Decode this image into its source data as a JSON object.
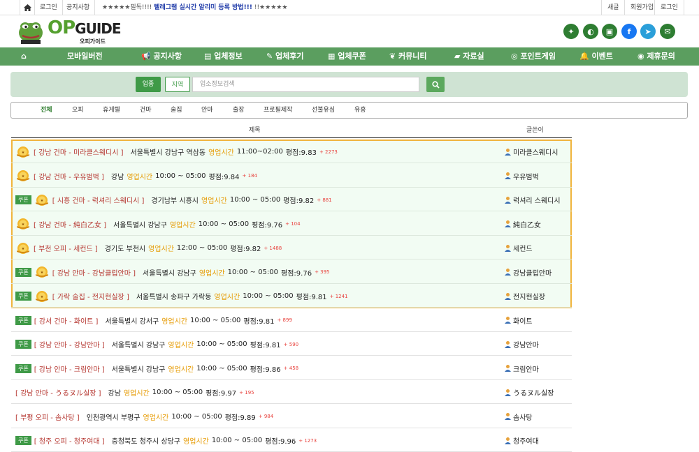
{
  "topbar": {
    "login": "로그인",
    "notice_link": "공지사항",
    "notice_prefix": "★★★★★필독!!!! ",
    "notice_bold": "텔레그램 실시간 알리미 등록 방법!!!",
    "notice_suffix": " !!★★★★★",
    "right": [
      "새글",
      "회원가입",
      "로그인"
    ]
  },
  "logo": {
    "main_op": "OP",
    "main_guide": "GUIDE",
    "sub": "오피가이드"
  },
  "social_icons": [
    {
      "name": "party-icon",
      "color": "#2e7d32",
      "glyph": "🎉"
    },
    {
      "name": "profile-icon",
      "color": "#2e7d32",
      "glyph": "◐"
    },
    {
      "name": "sim-card-icon",
      "color": "#2e7d32",
      "glyph": "▣"
    },
    {
      "name": "facebook-icon",
      "color": "#1877f2",
      "glyph": "f"
    },
    {
      "name": "telegram-icon",
      "color": "#2b9fd9",
      "glyph": "➤"
    },
    {
      "name": "mail-icon",
      "color": "#2e7d32",
      "glyph": "✉"
    }
  ],
  "nav": [
    "모바일버전",
    "공지사항",
    "업체정보",
    "업체후기",
    "업체쿠폰",
    "커뮤니티",
    "자료실",
    "포인트게임",
    "이벤트",
    "제휴문의"
  ],
  "search": {
    "btn_type": "업종",
    "btn_region": "지역",
    "placeholder": "업소정보검색"
  },
  "categories": [
    "전체",
    "오피",
    "휴게텔",
    "건마",
    "술집",
    "안마",
    "출장",
    "프로필제작",
    "선불유심",
    "유흥"
  ],
  "table": {
    "col_title": "제목",
    "col_author": "글쓴이"
  },
  "rows": [
    {
      "coupon": false,
      "medal": true,
      "bracket": "[ 강남 건마 - 미라클스웨디시 ]",
      "addr": "서울특별시 강남구 역삼동",
      "hours_label": "영업시간",
      "hours": "11:00~02:00",
      "score": "평점:9.83",
      "plus": "+ 2273",
      "author": "미라클스웨디시",
      "premium": true
    },
    {
      "coupon": false,
      "medal": true,
      "bracket": "[ 강남 건마 - 우유범벅 ]",
      "addr": "강남",
      "hours_label": "영업시간",
      "hours": "10:00 ~ 05:00",
      "score": "평점:9.84",
      "plus": "+ 184",
      "author": "우유범벅",
      "premium": true
    },
    {
      "coupon": true,
      "medal": true,
      "bracket": "[ 시흥 건마 - 럭셔리 스웨디시 ]",
      "addr": "경기남부 시흥시",
      "hours_label": "영업시간",
      "hours": "10:00 ~ 05:00",
      "score": "평점:9.82",
      "plus": "+ 881",
      "author": "럭셔리 스웨디시",
      "premium": true
    },
    {
      "coupon": false,
      "medal": true,
      "bracket": "[ 강남 건마 - 純白乙女 ]",
      "addr": "서울특별시 강남구",
      "hours_label": "영업시간",
      "hours": "10:00 ~ 05:00",
      "score": "평점:9.76",
      "plus": "+ 104",
      "author": "純白乙女",
      "premium": true
    },
    {
      "coupon": false,
      "medal": true,
      "bracket": "[ 부천 오피 - 세컨드 ]",
      "addr": "경기도 부천시",
      "hours_label": "영업시간",
      "hours": "12:00 ~ 05:00",
      "score": "평점:9.82",
      "plus": "+ 1488",
      "author": "세컨드",
      "premium": true
    },
    {
      "coupon": true,
      "medal": true,
      "bracket": "[ 강남 안마 - 강남클럽안마 ]",
      "addr": "서울특별시 강남구",
      "hours_label": "영업시간",
      "hours": "10:00 ~ 05:00",
      "score": "평점:9.76",
      "plus": "+ 395",
      "author": "강남클럽안마",
      "premium": true
    },
    {
      "coupon": true,
      "medal": true,
      "bracket": "[ 가락 술집 - 전지현실장 ]",
      "addr": "서울특별시 송파구 가락동",
      "hours_label": "영업시간",
      "hours": "10:00 ~ 05:00",
      "score": "평점:9.81",
      "plus": "+ 1241",
      "author": "전지현실장",
      "premium": true
    },
    {
      "coupon": true,
      "medal": false,
      "bracket": "[ 강서 건마 - 화이트 ]",
      "addr": "서울특별시 강서구",
      "hours_label": "영업시간",
      "hours": "10:00 ~ 05:00",
      "score": "평점:9.81",
      "plus": "+ 899",
      "author": "화이트",
      "premium": false
    },
    {
      "coupon": true,
      "medal": false,
      "bracket": "[ 강남 안마 - 강남안마 ]",
      "addr": "서울특별시 강남구",
      "hours_label": "영업시간",
      "hours": "10:00 ~ 05:00",
      "score": "평점:9.81",
      "plus": "+ 590",
      "author": "강남안마",
      "premium": false
    },
    {
      "coupon": true,
      "medal": false,
      "bracket": "[ 강남 안마 - 크림안마 ]",
      "addr": "서울특별시 강남구",
      "hours_label": "영업시간",
      "hours": "10:00 ~ 05:00",
      "score": "평점:9.86",
      "plus": "+ 458",
      "author": "크림안마",
      "premium": false
    },
    {
      "coupon": false,
      "medal": false,
      "bracket": "[ 강남 안마 - うるヌル실장 ]",
      "addr": "강남",
      "hours_label": "영업시간",
      "hours": "10:00 ~ 05:00",
      "score": "평점:9.97",
      "plus": "+ 195",
      "author": "うるヌル실장",
      "premium": false
    },
    {
      "coupon": false,
      "medal": false,
      "bracket": "[ 부평 오피 - 솜사탕 ]",
      "addr": "인천광역시 부평구",
      "hours_label": "영업시간",
      "hours": "10:00 ~ 05:00",
      "score": "평점:9.89",
      "plus": "+ 984",
      "author": "솜사탕",
      "premium": false
    },
    {
      "coupon": true,
      "medal": false,
      "bracket": "[ 청주 오피 - 청주여대 ]",
      "addr": "충청북도 청주시 상당구",
      "hours_label": "영업시간",
      "hours": "10:00 ~ 05:00",
      "score": "평점:9.96",
      "plus": "+ 1273",
      "author": "청주여대",
      "premium": false
    }
  ],
  "coupon_label": "쿠폰",
  "colors": {
    "brand_green": "#5b9e5f",
    "premium_border": "#f0b43c",
    "bracket_red": "#b5352f",
    "hours_orange": "#e69a00"
  }
}
